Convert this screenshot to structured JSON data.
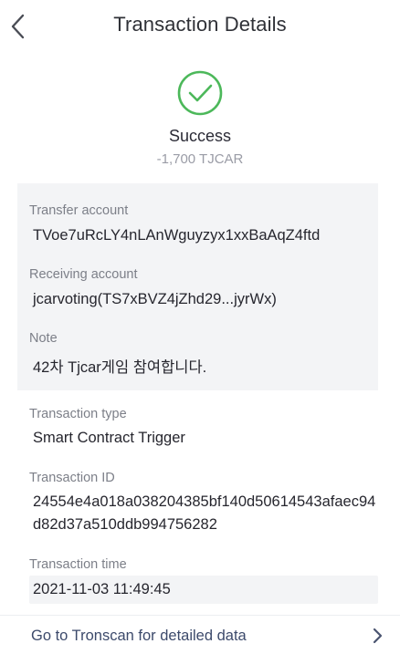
{
  "header": {
    "title": "Transaction Details",
    "back_icon": "chevron-left-icon"
  },
  "status": {
    "icon": "check-circle-icon",
    "icon_color": "#4cb85a",
    "text": "Success",
    "amount": "-1,700 TJCAR"
  },
  "details": {
    "transfer_account": {
      "label": "Transfer account",
      "value": "TVoe7uRcLY4nLAnWguyzyx1xxBaAqZ4ftd"
    },
    "receiving_account": {
      "label": "Receiving account",
      "value": "jcarvoting(TS7xBVZ4jZhd29...jyrWx)"
    },
    "note": {
      "label": "Note",
      "value": "42차 Tjcar게임 참여합니다."
    },
    "transaction_type": {
      "label": "Transaction type",
      "value": "Smart Contract Trigger"
    },
    "transaction_id": {
      "label": "Transaction ID",
      "value": "24554e4a018a038204385bf140d50614543afaec94d82d37a510ddb994756282"
    },
    "transaction_time": {
      "label": "Transaction time",
      "value": "2021-11-03 11:49:45"
    }
  },
  "footer": {
    "link_text": "Go to Tronscan for detailed data",
    "link_icon": "chevron-right-icon"
  }
}
